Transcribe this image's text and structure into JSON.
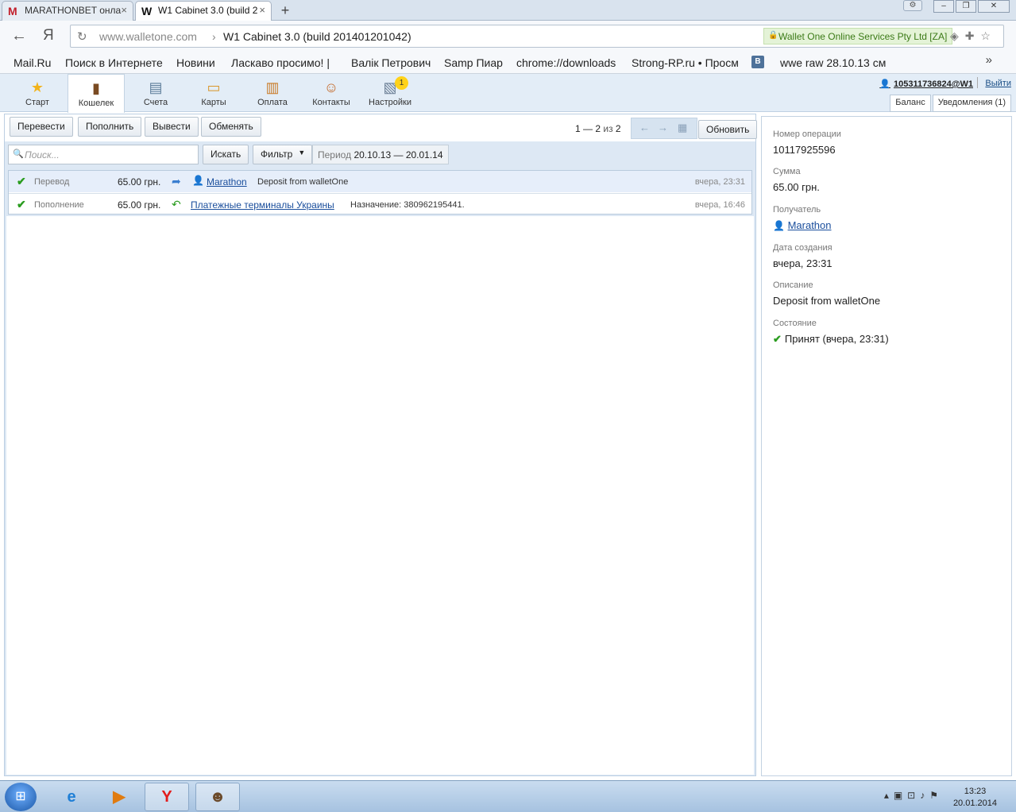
{
  "browser": {
    "tabs": [
      {
        "label": "MARATHONBET онла",
        "favicon": "M",
        "active": false
      },
      {
        "label": "W1 Cabinet 3.0 (build 2",
        "favicon": "W",
        "active": true
      }
    ],
    "close_glyph": "×",
    "new_tab_glyph": "+",
    "url_host": "www.walletone.com",
    "url_separator": "›",
    "page_title": "W1 Cabinet 3.0 (build 201401201042)",
    "ev_cert": "Wallet One Online Services Pty Ltd [ZA]",
    "bookmarks": [
      "Mail.Ru",
      "Поиск в Интернете",
      "Новини",
      "Ласкаво просимо! |",
      "Валік Петрович",
      "Samp Пиар",
      "chrome://downloads",
      "Strong-RP.ru • Просм",
      "wwe raw 28.10.13 см"
    ],
    "bookmark_vk": "В",
    "more_glyph": "»"
  },
  "app": {
    "nav": [
      {
        "label": "Старт",
        "icon": "star-icon",
        "glyph": "★",
        "color": "#f2b31b"
      },
      {
        "label": "Кошелек",
        "icon": "wallet-icon",
        "glyph": "▮",
        "color": "#7a4a22",
        "active": true
      },
      {
        "label": "Счета",
        "icon": "invoices-icon",
        "glyph": "▤",
        "color": "#5d7d9a"
      },
      {
        "label": "Карты",
        "icon": "cards-icon",
        "glyph": "▭",
        "color": "#d9962a"
      },
      {
        "label": "Оплата",
        "icon": "payment-icon",
        "glyph": "▥",
        "color": "#c97c2a"
      },
      {
        "label": "Контакты",
        "icon": "contacts-icon",
        "glyph": "☺",
        "color": "#c46a2a"
      },
      {
        "label": "Настройки",
        "icon": "settings-icon",
        "glyph": "▧",
        "color": "#6b7f96",
        "badge": "1"
      }
    ],
    "user": "105311736824@W1",
    "logout": "Выйти",
    "balance_tab": "Баланс",
    "notifications_tab": "Уведомления (1)"
  },
  "actions": {
    "transfer": "Перевести",
    "topup": "Пополнить",
    "withdraw": "Вывести",
    "exchange": "Обменять",
    "refresh": "Обновить"
  },
  "pager": {
    "range": "1 — 2",
    "of": "из",
    "total": "2",
    "prev": "←",
    "next": "→"
  },
  "search": {
    "placeholder": "Поиск...",
    "button": "Искать",
    "filter": "Фильтр",
    "period_label": "Период",
    "period_value": "20.10.13 — 20.01.14"
  },
  "transactions": [
    {
      "type": "Перевод",
      "amount": "65.00 грн.",
      "direction": "out",
      "counterparty": "Marathon",
      "description": "Deposit from walletOne",
      "time": "вчера, 23:31",
      "selected": true
    },
    {
      "type": "Пополнение",
      "amount": "65.00 грн.",
      "direction": "in",
      "counterparty": "Платежные терминалы Украины",
      "description": "Назначение: 380962195441.",
      "time": "вчера, 16:46",
      "selected": false
    }
  ],
  "details": {
    "op_number_label": "Номер операции",
    "op_number": "10117925596",
    "amount_label": "Сумма",
    "amount": "65.00 грн.",
    "recipient_label": "Получатель",
    "recipient": "Marathon",
    "created_label": "Дата создания",
    "created": "вчера, 23:31",
    "description_label": "Описание",
    "description": "Deposit from walletOne",
    "status_label": "Состояние",
    "status": "Принят (вчера, 23:31)"
  },
  "taskbar": {
    "time": "13:23",
    "date": "20.01.2014",
    "items": [
      "ie-icon",
      "media-player-icon",
      "yandex-browser-icon",
      "game-icon"
    ]
  }
}
